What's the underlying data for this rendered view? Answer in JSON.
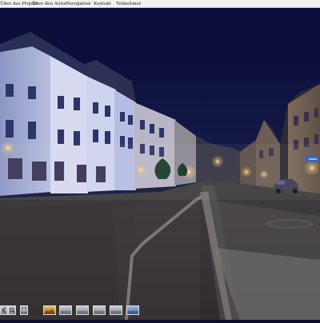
{
  "nav": {
    "items": [
      {
        "label": "Über das Projekt"
      },
      {
        "label": "Über den Autor"
      },
      {
        "label": "Navigation"
      },
      {
        "label": "Kontakt"
      },
      {
        "label": "Teilnehmer"
      }
    ]
  },
  "scene": {
    "alt": "panorama"
  },
  "toolbar": {
    "buttons": [
      {
        "icon": "left-arrow-icon"
      },
      {
        "icon": "zoom-icon"
      },
      {
        "icon": "fullscreen-icon"
      },
      {
        "icon": "thumbnail-icon"
      },
      {
        "icon": "thumbnail-icon"
      },
      {
        "icon": "thumbnail-icon"
      },
      {
        "icon": "thumbnail-icon"
      },
      {
        "icon": "thumbnail-icon"
      },
      {
        "icon": "thumbnail-icon"
      }
    ]
  }
}
